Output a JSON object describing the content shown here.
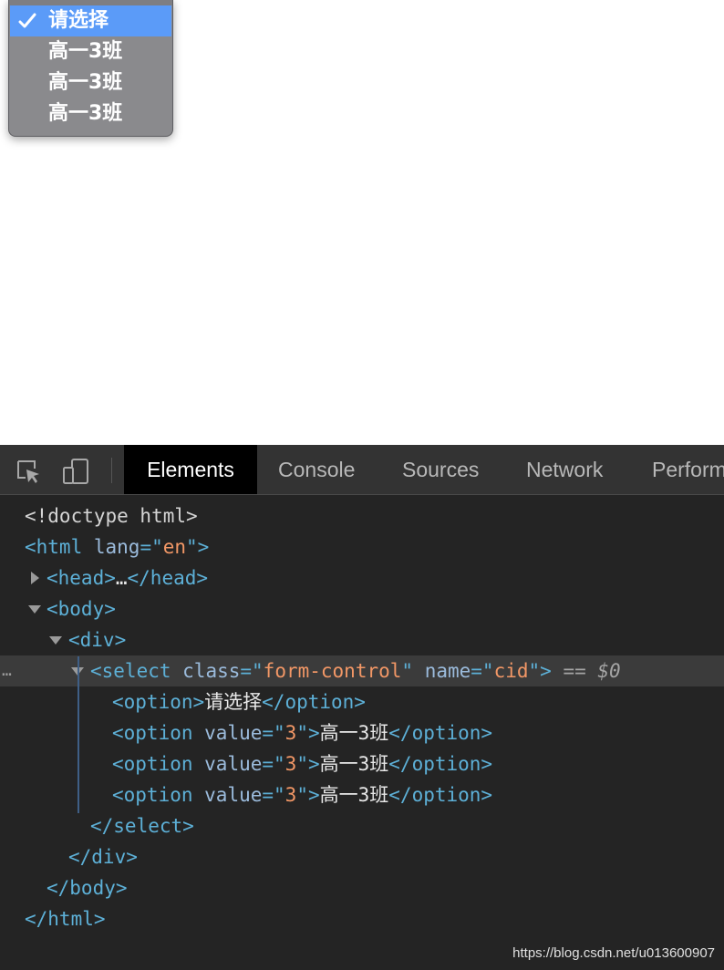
{
  "dropdown": {
    "options": [
      {
        "label": "请选择",
        "selected": true
      },
      {
        "label": "高一3班",
        "selected": false
      },
      {
        "label": "高一3班",
        "selected": false
      },
      {
        "label": "高一3班",
        "selected": false
      }
    ],
    "check_icon": "checkmark-icon"
  },
  "devtools": {
    "toolbar": {
      "icons": [
        "inspect-element-icon",
        "device-toggle-icon"
      ],
      "tabs": [
        "Elements",
        "Console",
        "Sources",
        "Network",
        "Perform"
      ],
      "active_tab": "Elements"
    },
    "tree": {
      "doctype": "<!doctype html>",
      "html_open": "<html ",
      "html_attr": "lang",
      "html_lang": "en",
      "head_open": "<head>",
      "head_ellipsis": "…",
      "head_close": "</head>",
      "body_open": "<body>",
      "div_open": "<div>",
      "select_open": "<select ",
      "select_class_attr": "class",
      "select_class_val": "form-control",
      "select_name_attr": "name",
      "select_name_val": "cid",
      "selected_marker": "== ",
      "selected_var": "$0",
      "options": [
        {
          "open": "<option>",
          "attr": "",
          "value": "",
          "text": "请选择",
          "close": "</option>"
        },
        {
          "open": "<option ",
          "attr": "value",
          "value": "3",
          "text": "高一3班",
          "close": "</option>"
        },
        {
          "open": "<option ",
          "attr": "value",
          "value": "3",
          "text": "高一3班",
          "close": "</option>"
        },
        {
          "open": "<option ",
          "attr": "value",
          "value": "3",
          "text": "高一3班",
          "close": "</option>"
        }
      ],
      "select_close": "</select>",
      "div_close": "</div>",
      "body_close": "</body>",
      "html_close": "</html>",
      "dots": "…"
    },
    "watermark": "https://blog.csdn.net/u013600907"
  },
  "colors": {
    "selection": "#5b9bf8",
    "tag": "#5db0d7",
    "attr_value": "#f29766"
  }
}
